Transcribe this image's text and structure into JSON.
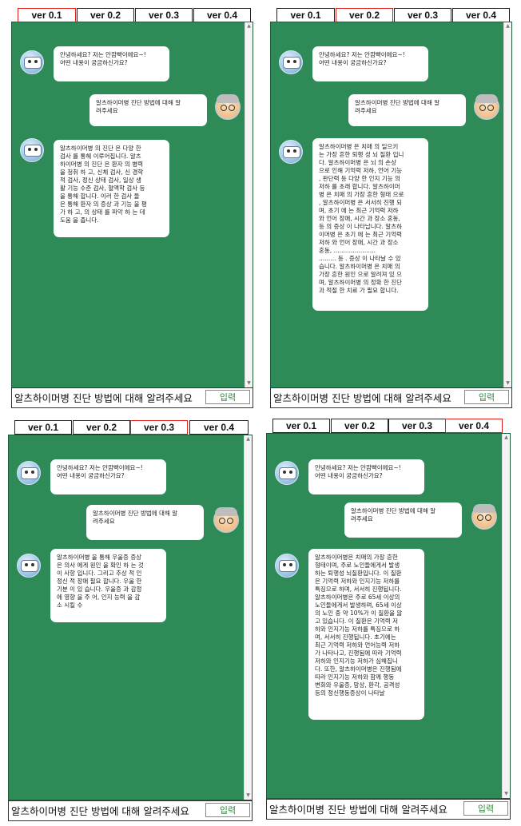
{
  "tabs": [
    "ver 0.1",
    "ver 0.2",
    "ver 0.3",
    "ver 0.4"
  ],
  "input_value": "알츠하이머병 진단 방법에 대해 알려주세요",
  "send_label": "입력",
  "colors": {
    "chat_bg": "#2e8b57",
    "active_tab_border": "#e0201c"
  },
  "icons": {
    "bot": "bot-avatar-icon",
    "user": "user-avatar-icon"
  },
  "panels": [
    {
      "version": "ver 0.1",
      "greeting": "안녕하세요? 저는 안깜빡이에요~!\n어떤 내용이 궁금하신가요?",
      "question": "알츠하이머병 진단 방법에 대해 알\n려주세요",
      "answer": "알츠하이머병 의 진단 은 다양 한\n검사 를 통해 이루어집니다. 알츠\n하이머병 의 진단 은 환자 의 병력\n을 청취 하 고, 신체 검사, 신 경학\n적 검사, 정신 상태 검사, 일상 생\n활 기능 수준 검사, 혈액학 검사 등\n을 통해 합니다. 이러 한 검사 들\n은 통해 환자 의 증상 과 기능 을 평\n가 하 고, 의 상태 를 파악 하 는 데\n도움 을 줍니다."
    },
    {
      "version": "ver 0.2",
      "greeting": "안녕하세요? 저는 안깜빡이에요~!\n어떤 내용이 궁금하신가요?",
      "question": "알츠하이머병 진단 방법에 대해 알\n려주세요",
      "answer": "알츠하이머병 은 치매 의 일으키\n는 가장 흔한 퇴행 성 뇌 질환 입니\n다. 알츠하이머병 은 뇌 의 손상\n으로 인해 기억력 저하, 언어 기능\n, 판단력 등 다양 한 인지 기능 의\n저하 를 초래 합니다. 알츠하이머\n병 은 치매 의 가장 흔한 형태 으로\n, 알츠하이머병 은 서서히 진행 되\n며, 초기 에 는 최근 기억력 저하\n와 언어 장애, 시간 과 장소 혼동,\n등 의 증상 이 나타납니다. 알츠하\n이머병 은 초기 에 는 최근 기억력\n저하 와 언어 장애, 시간 과 장소\n혼동, ......................\n......... 등 . 증상 이 나타날 수 있\n습니다. 알츠하이머병 은 치매 의\n가장 흔한 원인 으로 알려져 있 으\n며, 알츠하이머병 의 정확 한 진단\n과 적절 한 치료 가 필요 합니다."
    },
    {
      "version": "ver 0.3",
      "greeting": "안녕하세요? 저는 안깜빡이에요~!\n어떤 내용이 궁금하신가요?",
      "question": "알츠하이머병 진단 방법에 대해 알\n려주세요",
      "answer": "알츠하이머병 을 통해 우울증 증상\n은 의사 에게 원인 을 확인 하 는 것\n이 사항 입니다. 그리고 추상 적 인\n정신 적 장애 필요 합니다. 우울 한\n기분 이 있 습니다. 우울증 과 감정\n에 영향 을 주 어, 인지 능력 을 감\n소 시킬 수"
    },
    {
      "version": "ver 0.4",
      "greeting": "안녕하세요? 저는 안깜빡이에요~!\n어떤 내용이 궁금하신가요?",
      "question": "알츠하이머병 진단 방법에 대해 알\n려주세요",
      "answer": "알츠하이머병은 치매의 가장 흔한\n형태이며, 주로 노인들에게서 발생\n하는 퇴행성 뇌질환입니다. 이 질환\n은 기억력 저하와 인지기능 저하를\n특징으로 하며, 서서히 진행됩니다.\n알츠하이머병은 주로 65세 이상의\n노인들에게서 발생하며, 65세 이상\n의 노인 중 약 10%가 이 질환을 앓\n고 있습니다. 이 질환은 기억력 저\n하와 인지기능 저하를 특징으로 하\n며, 서서히 진행됩니다. 초기에는\n최근 기억력 저하와 언어능력 저하\n가 나타나고, 진행됨에 따라 기억력\n저하와 인지기능 저하가 심해집니\n다. 또한, 알츠하이머병은 진행됨에\n따라 인지기능 저하와 함께 행동\n변화와 우울증, 망상, 환각, 공격성\n등의 정신행동증상이 나타날"
    }
  ]
}
